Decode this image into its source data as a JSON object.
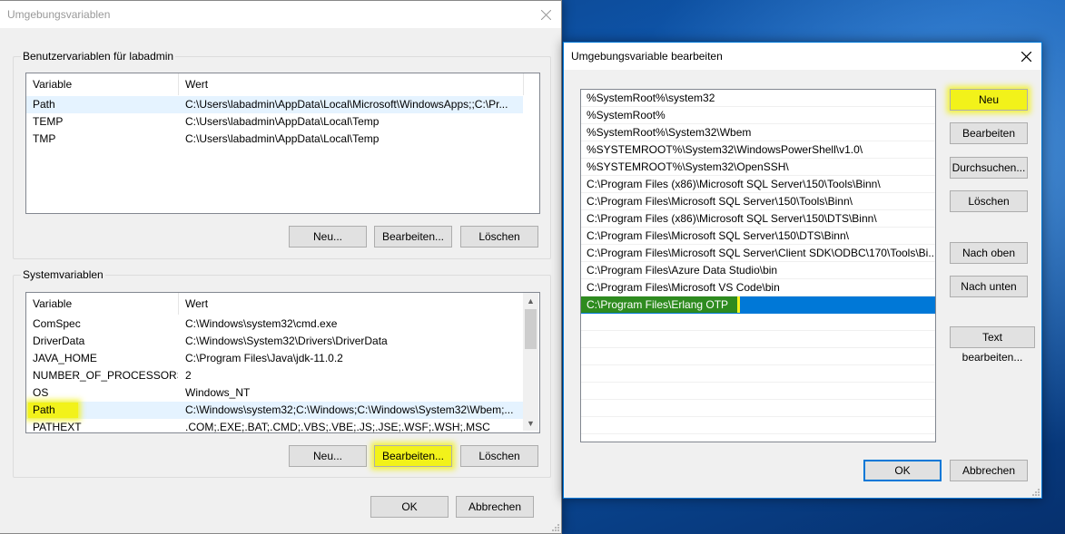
{
  "env_dialog": {
    "title": "Umgebungsvariablen",
    "user_group_label": "Benutzervariablen für labadmin",
    "user_columns": [
      "Variable",
      "Wert"
    ],
    "user_rows": [
      {
        "name": "Path",
        "value": "C:\\Users\\labadmin\\AppData\\Local\\Microsoft\\WindowsApps;;C:\\Pr..."
      },
      {
        "name": "TEMP",
        "value": "C:\\Users\\labadmin\\AppData\\Local\\Temp"
      },
      {
        "name": "TMP",
        "value": "C:\\Users\\labadmin\\AppData\\Local\\Temp"
      }
    ],
    "user_buttons": {
      "new": "Neu...",
      "edit": "Bearbeiten...",
      "delete": "Löschen"
    },
    "system_group_label": "Systemvariablen",
    "system_columns": [
      "Variable",
      "Wert"
    ],
    "system_rows": [
      {
        "name": "ComSpec",
        "value": "C:\\Windows\\system32\\cmd.exe"
      },
      {
        "name": "DriverData",
        "value": "C:\\Windows\\System32\\Drivers\\DriverData"
      },
      {
        "name": "JAVA_HOME",
        "value": "C:\\Program Files\\Java\\jdk-11.0.2"
      },
      {
        "name": "NUMBER_OF_PROCESSORS",
        "value": "2"
      },
      {
        "name": "OS",
        "value": "Windows_NT"
      },
      {
        "name": "Path",
        "value": "C:\\Windows\\system32;C:\\Windows;C:\\Windows\\System32\\Wbem;..."
      },
      {
        "name": "PATHEXT",
        "value": ".COM;.EXE;.BAT;.CMD;.VBS;.VBE;.JS;.JSE;.WSF;.WSH;.MSC"
      }
    ],
    "system_buttons": {
      "new": "Neu...",
      "edit": "Bearbeiten...",
      "delete": "Löschen"
    },
    "ok": "OK",
    "cancel": "Abbrechen"
  },
  "edit_dialog": {
    "title": "Umgebungsvariable bearbeiten",
    "entries": [
      "%SystemRoot%\\system32",
      "%SystemRoot%",
      "%SystemRoot%\\System32\\Wbem",
      "%SYSTEMROOT%\\System32\\WindowsPowerShell\\v1.0\\",
      "%SYSTEMROOT%\\System32\\OpenSSH\\",
      "C:\\Program Files (x86)\\Microsoft SQL Server\\150\\Tools\\Binn\\",
      "C:\\Program Files\\Microsoft SQL Server\\150\\Tools\\Binn\\",
      "C:\\Program Files (x86)\\Microsoft SQL Server\\150\\DTS\\Binn\\",
      "C:\\Program Files\\Microsoft SQL Server\\150\\DTS\\Binn\\",
      "C:\\Program Files\\Microsoft SQL Server\\Client SDK\\ODBC\\170\\Tools\\Bi...",
      "C:\\Program Files\\Azure Data Studio\\bin",
      "C:\\Program Files\\Microsoft VS Code\\bin",
      "C:\\Program Files\\Erlang OTP"
    ],
    "selected_entry": "C:\\Program Files\\Erlang OTP",
    "buttons": {
      "new": "Neu",
      "edit": "Bearbeiten",
      "browse": "Durchsuchen...",
      "delete": "Löschen",
      "move_up": "Nach oben",
      "move_down": "Nach unten",
      "edit_text": "Text bearbeiten..."
    },
    "ok": "OK",
    "cancel": "Abbrechen"
  },
  "colors": {
    "highlight": "#f2f21a",
    "selection": "#0078d7",
    "desktop": "#0f5bb5"
  }
}
